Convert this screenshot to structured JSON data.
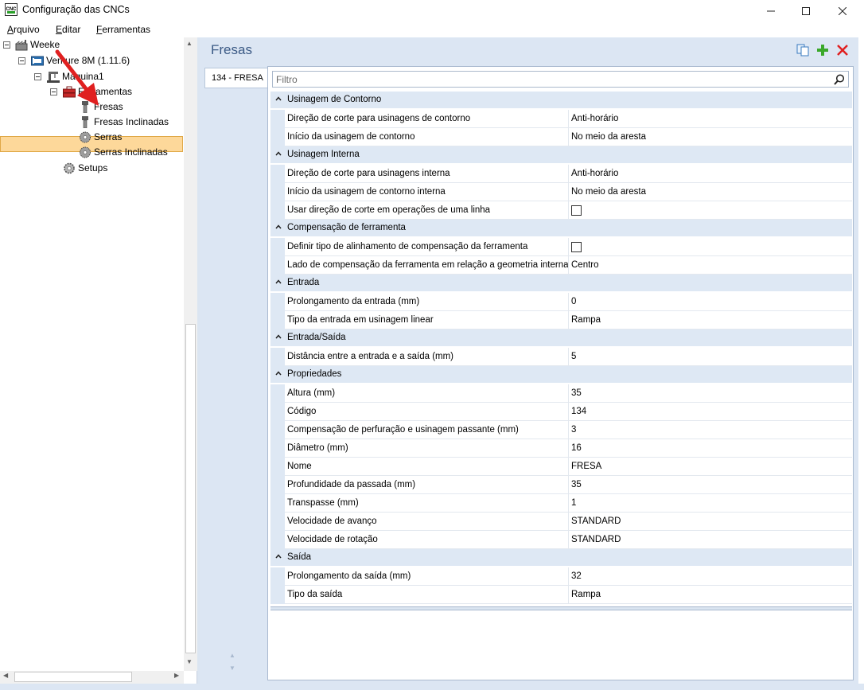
{
  "window": {
    "title": "Configuração das CNCs",
    "app_icon_text": "CNC"
  },
  "menu": [
    {
      "label": "Arquivo",
      "underline": "A",
      "rest": "rquivo"
    },
    {
      "label": "Editar",
      "underline": "E",
      "rest": "ditar"
    },
    {
      "label": "Ferramentas",
      "underline": "F",
      "rest": "erramentas"
    }
  ],
  "tree": {
    "root": "Weeke",
    "machine": "Venture 8M (1.11.6)",
    "maquina": "Maquina1",
    "ferramentas": "Ferramentas",
    "fresas": "Fresas",
    "fresas_inclinadas": "Fresas Inclinadas",
    "serras": "Serras",
    "serras_inclinadas": "Serras Inclinadas",
    "setups": "Setups",
    "selected": "Fresas"
  },
  "panel": {
    "title": "Fresas",
    "tab_label": "134 - FRESA",
    "filter_placeholder": "Filtro"
  },
  "categories": [
    {
      "name": "Usinagem de Contorno",
      "props": [
        {
          "name": "Direção de corte para usinagens de contorno",
          "value": "Anti-horário"
        },
        {
          "name": "Início da usinagem de contorno",
          "value": "No meio da aresta"
        }
      ]
    },
    {
      "name": "Usinagem Interna",
      "props": [
        {
          "name": "Direção de corte para usinagens interna",
          "value": "Anti-horário"
        },
        {
          "name": "Início da usinagem de contorno interna",
          "value": "No meio da aresta"
        },
        {
          "name": "Usar direção de corte em operações de uma linha",
          "checkbox": true,
          "checked": false
        }
      ]
    },
    {
      "name": "Compensação de ferramenta",
      "props": [
        {
          "name": "Definir tipo de alinhamento de compensação da ferramenta",
          "checkbox": true,
          "checked": false
        },
        {
          "name": "Lado de compensação da ferramenta em relação a geometria interna",
          "value": "Centro"
        }
      ]
    },
    {
      "name": "Entrada",
      "props": [
        {
          "name": "Prolongamento da entrada (mm)",
          "value": "0"
        },
        {
          "name": "Tipo da entrada em usinagem linear",
          "value": "Rampa"
        }
      ]
    },
    {
      "name": "Entrada/Saída",
      "props": [
        {
          "name": "Distância entre a entrada e a saída (mm)",
          "value": "5"
        }
      ]
    },
    {
      "name": "Propriedades",
      "props": [
        {
          "name": "Altura (mm)",
          "value": "35"
        },
        {
          "name": "Código",
          "value": "134"
        },
        {
          "name": "Compensação de perfuração e usinagem passante (mm)",
          "value": "3"
        },
        {
          "name": "Diâmetro (mm)",
          "value": "16"
        },
        {
          "name": "Nome",
          "value": "FRESA"
        },
        {
          "name": "Profundidade da passada (mm)",
          "value": "35"
        },
        {
          "name": "Transpasse (mm)",
          "value": "1"
        },
        {
          "name": "Velocidade de avanço",
          "value": "STANDARD"
        },
        {
          "name": "Velocidade de rotação",
          "value": "STANDARD"
        }
      ]
    },
    {
      "name": "Saída",
      "props": [
        {
          "name": "Prolongamento da saída (mm)",
          "value": "32"
        },
        {
          "name": "Tipo da saída",
          "value": "Rampa"
        }
      ]
    }
  ],
  "colors": {
    "selection_fill": "#fdd89a",
    "category_bg": "#dee8f4",
    "panel_bg": "#dce6f3",
    "title_color": "#3b5a85",
    "annotation_arrow": "#e02020"
  },
  "icons": {
    "copy": "copy-icon",
    "add": "add-icon",
    "delete": "delete-icon",
    "search": "search-icon"
  }
}
